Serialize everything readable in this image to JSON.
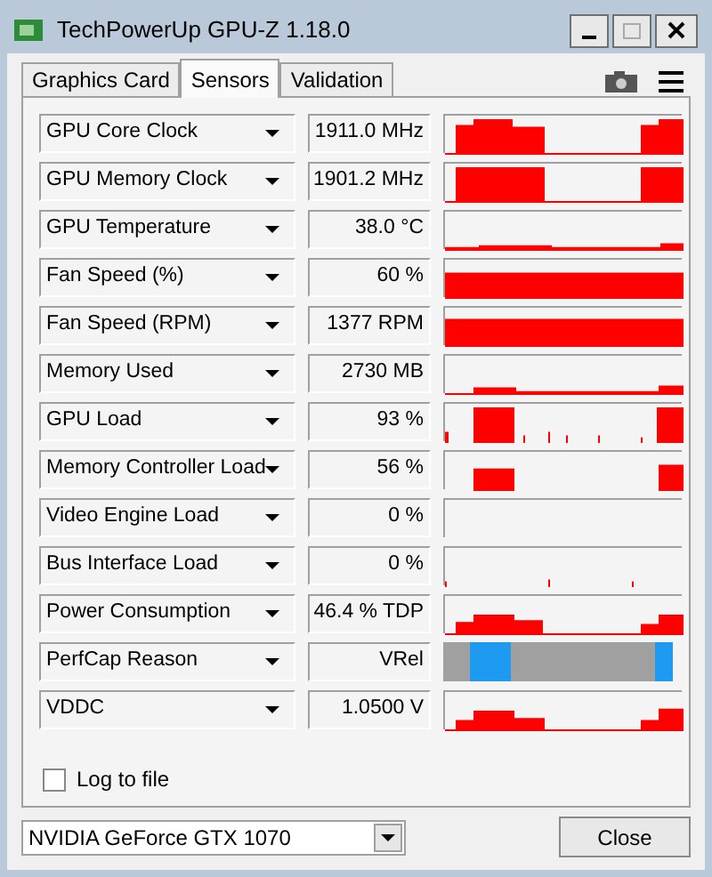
{
  "window": {
    "title": "TechPowerUp GPU-Z 1.18.0"
  },
  "tabs": [
    {
      "label": "Graphics Card",
      "selected": false
    },
    {
      "label": "Sensors",
      "selected": true
    },
    {
      "label": "Validation",
      "selected": false
    }
  ],
  "sensors": [
    {
      "name": "GPU Core Clock",
      "value": "1911.0 MHz",
      "kind": "line"
    },
    {
      "name": "GPU Memory Clock",
      "value": "1901.2 MHz",
      "kind": "line"
    },
    {
      "name": "GPU Temperature",
      "value": "38.0 °C",
      "kind": "line"
    },
    {
      "name": "Fan Speed (%)",
      "value": "60 %",
      "kind": "line"
    },
    {
      "name": "Fan Speed (RPM)",
      "value": "1377 RPM",
      "kind": "line"
    },
    {
      "name": "Memory Used",
      "value": "2730 MB",
      "kind": "line"
    },
    {
      "name": "GPU Load",
      "value": "93 %",
      "kind": "line"
    },
    {
      "name": "Memory Controller Load",
      "value": "56 %",
      "kind": "line"
    },
    {
      "name": "Video Engine Load",
      "value": "0 %",
      "kind": "line"
    },
    {
      "name": "Bus Interface Load",
      "value": "0 %",
      "kind": "line"
    },
    {
      "name": "Power Consumption",
      "value": "46.4 % TDP",
      "kind": "line"
    },
    {
      "name": "PerfCap Reason",
      "value": "VRel",
      "kind": "perfcap"
    },
    {
      "name": "VDDC",
      "value": "1.0500 V",
      "kind": "line"
    }
  ],
  "log_to_file": {
    "label": "Log to file",
    "checked": false
  },
  "gpu_select": {
    "value": "NVIDIA GeForce GTX 1070"
  },
  "close_button": "Close"
}
